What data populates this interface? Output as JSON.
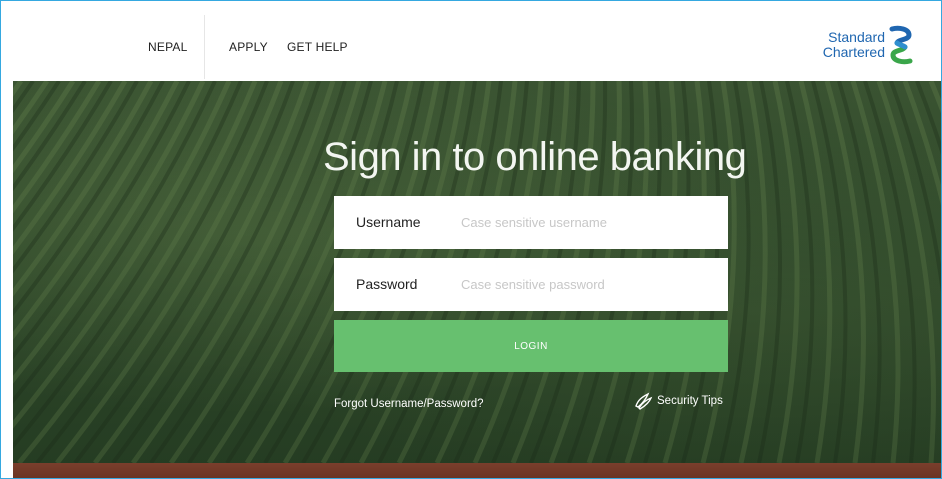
{
  "header": {
    "country": "NEPAL",
    "nav": {
      "apply": "APPLY",
      "get_help": "GET HELP"
    },
    "logo": {
      "line1": "Standard",
      "line2": "Chartered"
    }
  },
  "hero": {
    "title": "Sign in to online banking",
    "username": {
      "label": "Username",
      "placeholder": "Case sensitive username"
    },
    "password": {
      "label": "Password",
      "placeholder": "Case sensitive password"
    },
    "login_label": "LOGIN",
    "forgot_label": "Forgot Username/Password?",
    "security_tips_label": "Security Tips"
  },
  "colors": {
    "accent_green": "#67c06f",
    "brand_blue": "#1f66b0",
    "brand_green": "#3aa64a",
    "frame_border": "#35a8e0"
  },
  "icons": {
    "logo_mark": "standard-chartered-wave-icon",
    "security": "security-tips-icon"
  }
}
